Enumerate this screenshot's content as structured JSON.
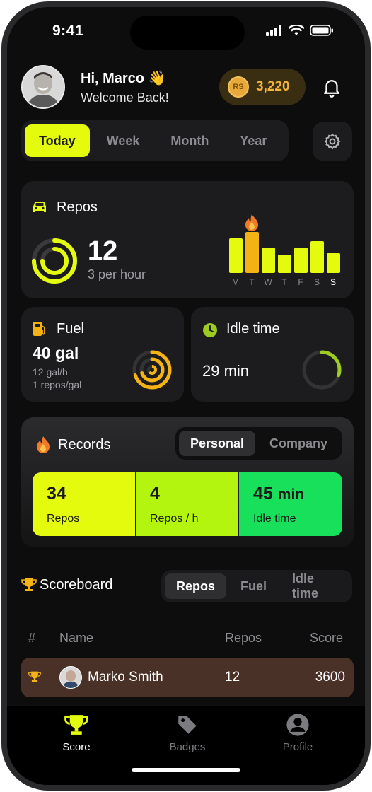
{
  "status": {
    "time": "9:41"
  },
  "header": {
    "greeting": "Hi, Marco",
    "wave": "👋",
    "subtitle": "Welcome Back!",
    "coins": "3,220",
    "coin_symbol": "RS"
  },
  "period_tabs": [
    "Today",
    "Week",
    "Month",
    "Year"
  ],
  "repos_card": {
    "title": "Repos",
    "value": "12",
    "rate": "3 per hour",
    "ring_progress": 0.75,
    "weekly": [
      0.85,
      1.0,
      0.62,
      0.45,
      0.62,
      0.78,
      0.48
    ],
    "highlight_day": 1,
    "days": [
      "M",
      "T",
      "W",
      "T",
      "F",
      "S",
      "S"
    ]
  },
  "fuel_card": {
    "title": "Fuel",
    "value": "40 gal",
    "line1": "12 gal/h",
    "line2": "1 repos/gal",
    "progress": 0.7
  },
  "idle_card": {
    "title": "Idle time",
    "value": "29 min",
    "progress": 0.3
  },
  "records": {
    "title": "Records",
    "tabs": [
      "Personal",
      "Company"
    ],
    "stats": [
      {
        "value": "34",
        "unit": "",
        "label": "Repos",
        "color": "#e4fb0d"
      },
      {
        "value": "4",
        "unit": "",
        "label": "Repos / h",
        "color": "#b4f50f"
      },
      {
        "value": "45",
        "unit": "min",
        "label": "Idle time",
        "color": "#18e05b"
      }
    ]
  },
  "scoreboard": {
    "title": "Scoreboard",
    "tabs": [
      "Repos",
      "Fuel",
      "Idle time"
    ],
    "columns": [
      "#",
      "Name",
      "Repos",
      "Score"
    ],
    "rows": [
      {
        "name": "Marko Smith",
        "repos": "12",
        "score": "3600"
      }
    ]
  },
  "tabbar": [
    {
      "label": "Score",
      "icon": "trophy-icon"
    },
    {
      "label": "Badges",
      "icon": "tag-icon"
    },
    {
      "label": "Profile",
      "icon": "person-icon"
    }
  ],
  "colors": {
    "accent": "#e4fb0d",
    "orange": "#f4b214",
    "green": "#9ccc20"
  }
}
